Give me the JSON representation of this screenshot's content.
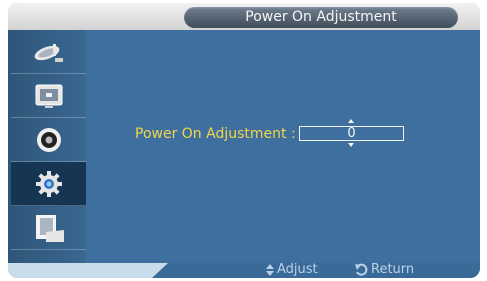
{
  "title": "Power On Adjustment",
  "setting": {
    "label": "Power On Adjustment :",
    "value": "0"
  },
  "sidebar": {
    "items": [
      {
        "icon": "satellite-dish-icon",
        "active": false
      },
      {
        "icon": "picture-icon",
        "active": false
      },
      {
        "icon": "speaker-icon",
        "active": false
      },
      {
        "icon": "gear-icon",
        "active": true
      },
      {
        "icon": "multi-screen-icon",
        "active": false
      }
    ]
  },
  "footer": {
    "adjust_label": "Adjust",
    "adjust_icon": "up-down-arrow-icon",
    "return_label": "Return",
    "return_icon": "return-icon"
  },
  "colors": {
    "panel": "#3e6f9e",
    "label": "#f0d64a",
    "active_item": "#163552"
  }
}
